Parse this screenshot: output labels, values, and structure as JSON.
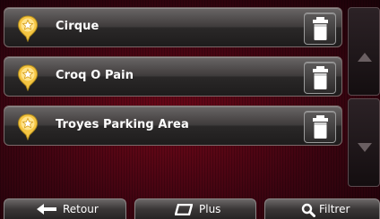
{
  "places": [
    {
      "name": "Cirque",
      "icon": "star-pin-icon"
    },
    {
      "name": "Croq O Pain",
      "icon": "star-pin-icon"
    },
    {
      "name": "Troyes Parking Area",
      "icon": "star-pin-icon"
    }
  ],
  "row_action_icon": "trash-icon",
  "scroll": {
    "up_icon": "triangle-up-icon",
    "down_icon": "triangle-down-icon"
  },
  "bottom_bar": {
    "back_label": "Retour",
    "more_label": "Plus",
    "filter_label": "Filtrer"
  },
  "colors": {
    "background": "#3a0410",
    "row_gradient_top": "#6a6666",
    "pin_yellow": "#f5c542",
    "text": "#ffffff"
  }
}
